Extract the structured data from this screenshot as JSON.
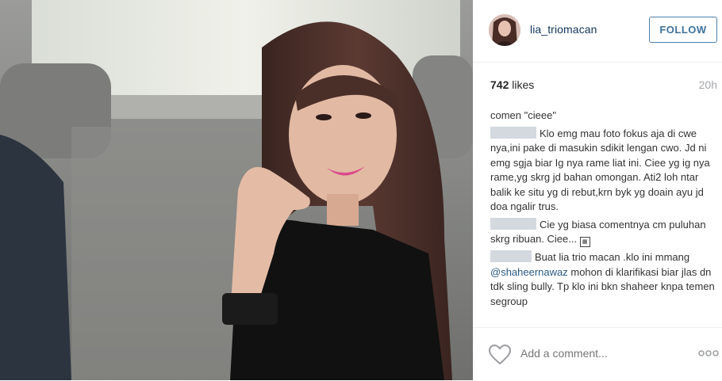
{
  "post": {
    "username": "lia_triomacan",
    "follow_label": "FOLLOW",
    "likes": "742",
    "likes_suffix": " likes",
    "time": "20h"
  },
  "comments": [
    {
      "text": "comen \"cieee\""
    },
    {
      "text": "Klo emg mau foto fokus aja di cwe nya,ini pake di masukin sdikit lengan cwo. Jd ni emg sgja biar Ig nya rame liat ini. Ciee yg ig nya rame,yg skrg jd bahan omongan. Ati2 loh ntar balik ke situ yg di rebut,krn byk yg doain ayu jd doa ngalir trus."
    },
    {
      "text": "Cie yg biasa comentnya cm puluhan skrg ribuan. Ciee..."
    },
    {
      "text_a": "Buat lia trio macan .klo ini mmang ",
      "mention": "@shaheernawaz",
      "text_b": " mohon di klarifikasi biar jlas dn tdk sling bully. Tp klo ini bkn shaheer knpa temen segroup"
    }
  ],
  "footer": {
    "add_comment_placeholder": "Add a comment..."
  },
  "icons": {
    "like": "heart-icon",
    "options": "ellipsis-icon"
  }
}
